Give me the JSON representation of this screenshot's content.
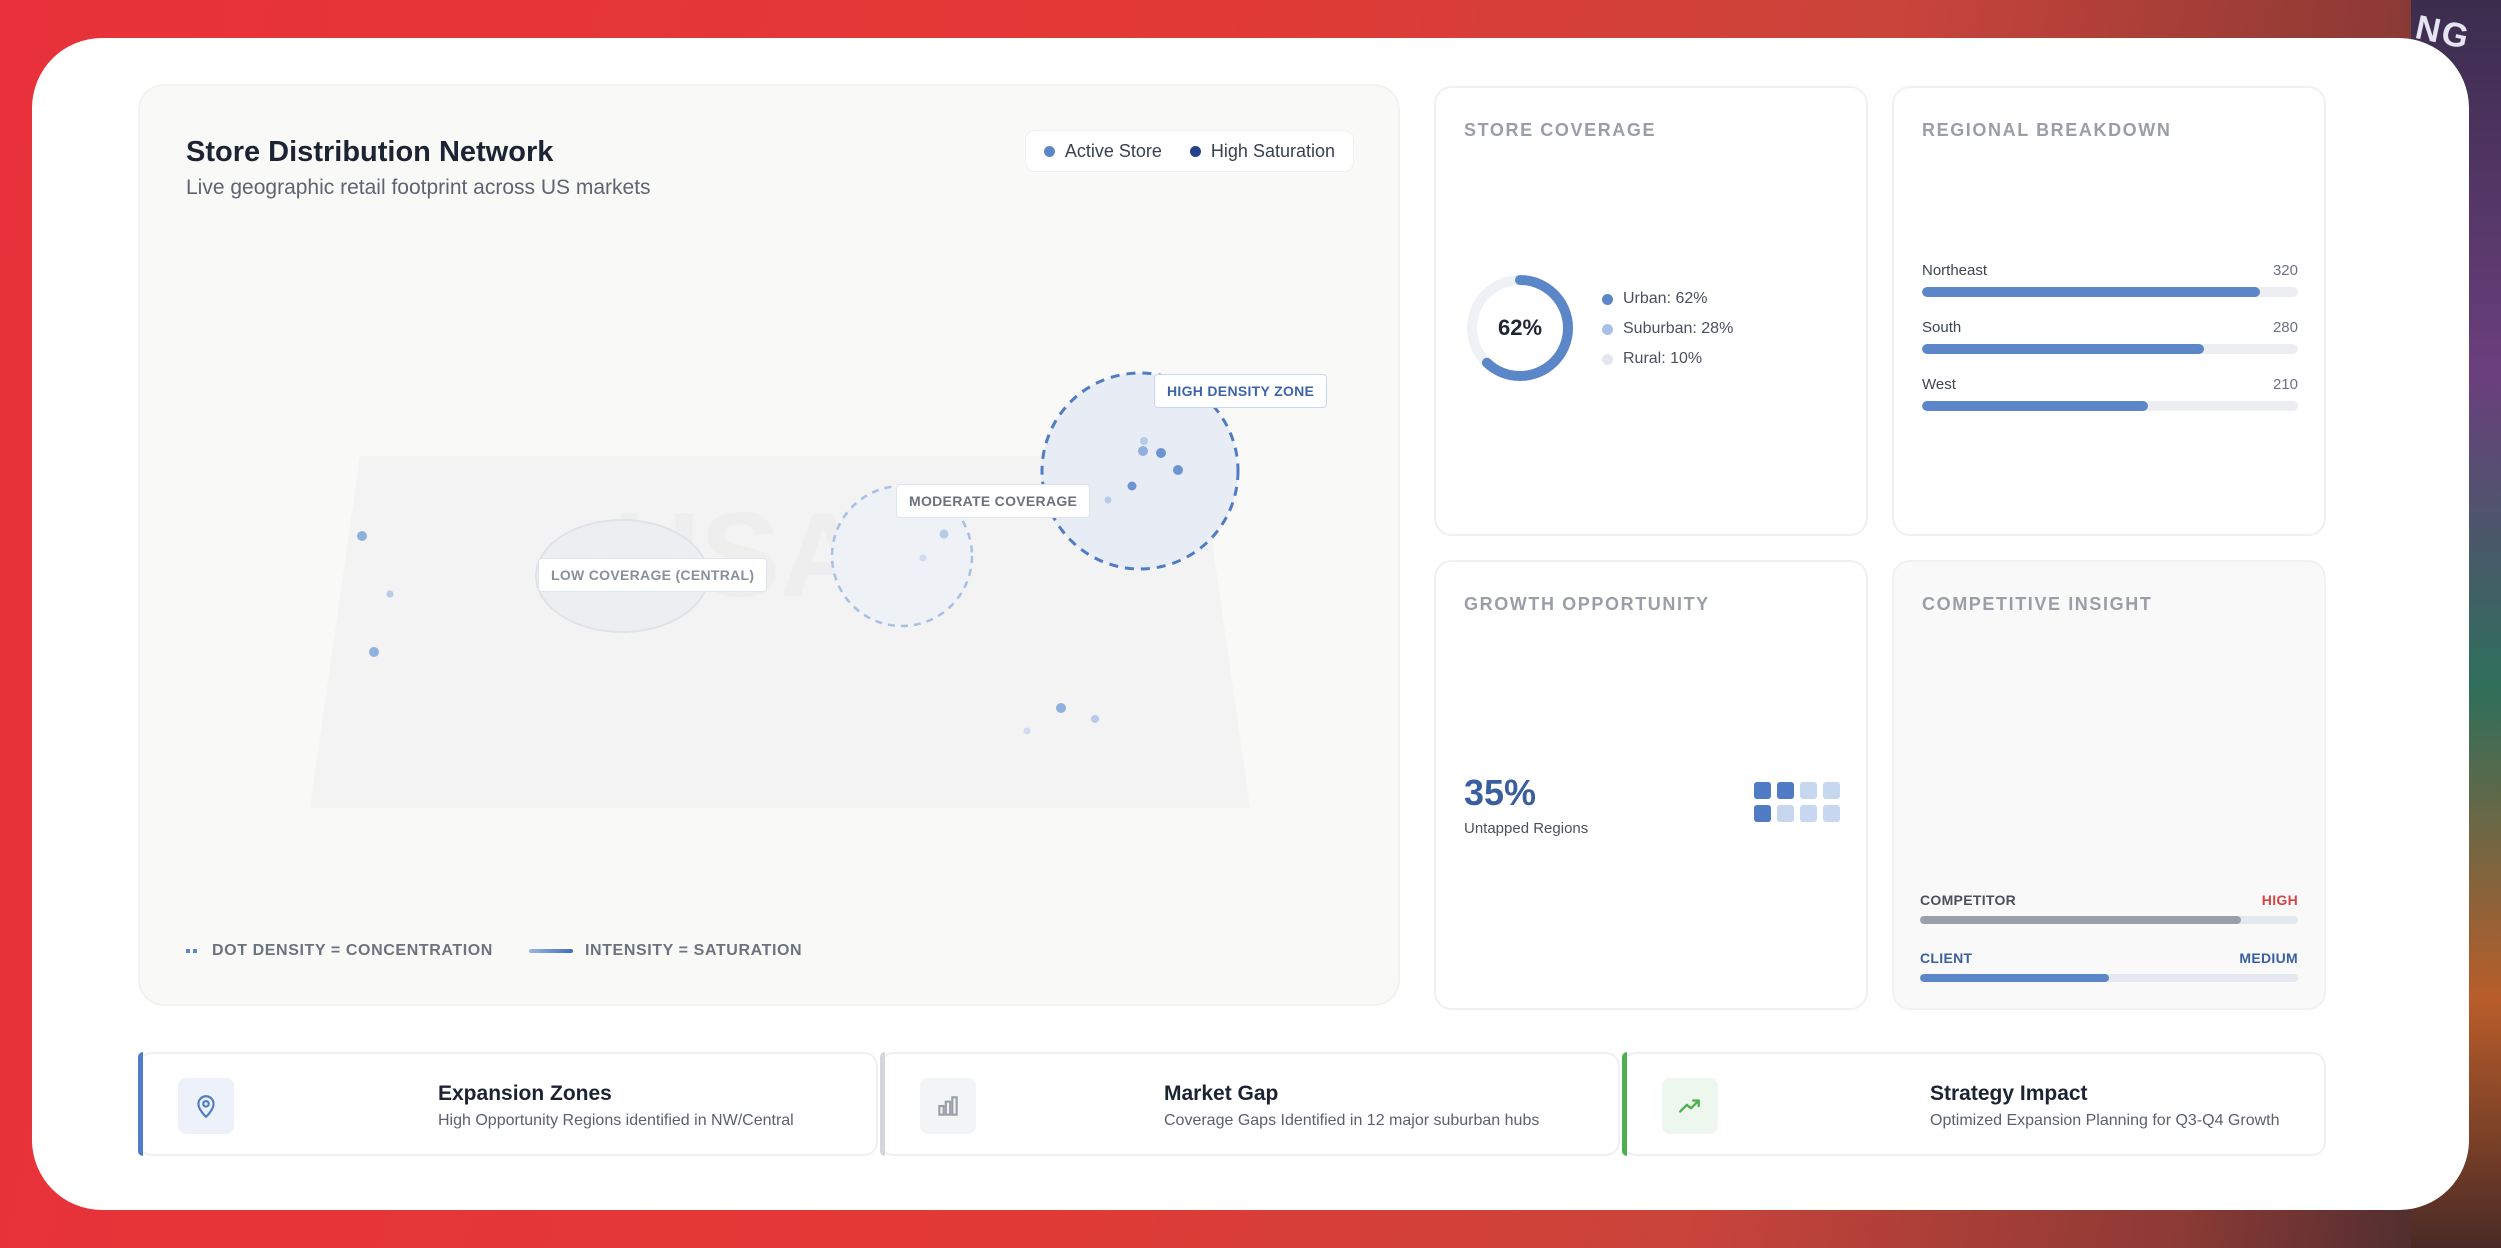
{
  "decor": {
    "badge": "NG N"
  },
  "map": {
    "title": "Store Distribution Network",
    "subtitle": "Live geographic retail footprint across US markets",
    "legend": {
      "active": "Active Store",
      "saturation": "High Saturation"
    },
    "watermark": "USA",
    "zones": {
      "high": "HIGH DENSITY ZONE",
      "moderate": "MODERATE COVERAGE",
      "low": "LOW COVERAGE (CENTRAL)"
    },
    "footer": {
      "density": "DOT DENSITY = CONCENTRATION",
      "intensity": "INTENSITY = SATURATION"
    }
  },
  "coverage": {
    "title": "STORE COVERAGE",
    "percent_label": "62%",
    "percent_value": 62,
    "items": [
      "Urban: 62%",
      "Suburban: 28%",
      "Rural: 10%"
    ]
  },
  "regional": {
    "title": "REGIONAL BREAKDOWN",
    "rows": [
      {
        "name": "Northeast",
        "value": "320",
        "fill_pct": 90
      },
      {
        "name": "South",
        "value": "280",
        "fill_pct": 75
      },
      {
        "name": "West",
        "value": "210",
        "fill_pct": 60
      }
    ]
  },
  "growth": {
    "title": "GROWTH OPPORTUNITY",
    "value": "35%",
    "label": "Untapped Regions"
  },
  "competitive": {
    "title": "COMPETITIVE INSIGHT",
    "competitor": {
      "label": "COMPETITOR",
      "level": "HIGH",
      "fill_pct": 85
    },
    "client": {
      "label": "CLIENT",
      "level": "MEDIUM",
      "fill_pct": 50
    }
  },
  "kpis": [
    {
      "title": "Expansion Zones",
      "sub": "High Opportunity Regions identified in NW/Central"
    },
    {
      "title": "Market Gap",
      "sub": "Coverage Gaps Identified in 12 major suburban hubs"
    },
    {
      "title": "Strategy Impact",
      "sub": "Optimized Expansion Planning for Q3-Q4 Growth"
    }
  ],
  "colors": {
    "accent": "#5b87c8",
    "accent_dark": "#3a5f9f",
    "danger": "#d64545",
    "success": "#4caf50"
  }
}
